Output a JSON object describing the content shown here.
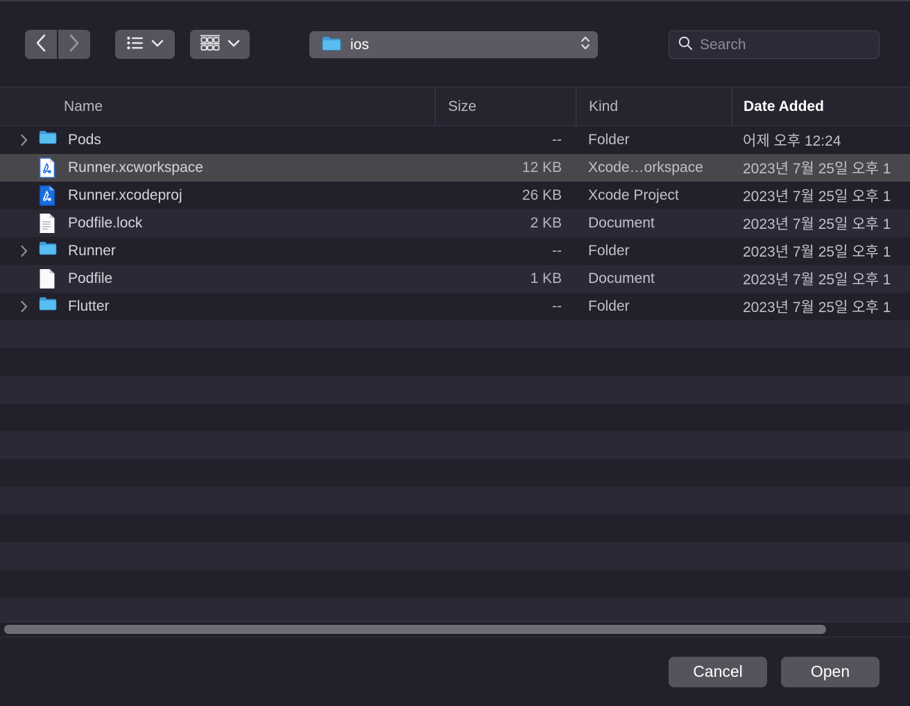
{
  "toolbar": {
    "back_icon": "chevron-left-icon",
    "forward_icon": "chevron-right-icon",
    "view_mode_icon": "list-view-icon",
    "view_mode_chevron": "chevron-down-icon",
    "group_mode_icon": "grid-view-icon",
    "group_mode_chevron": "chevron-down-icon",
    "path_label": "ios",
    "path_icon": "folder-icon",
    "path_stepper_icon": "up-down-chevron-icon",
    "search_icon": "magnifier-icon",
    "search_value": "",
    "search_placeholder": "Search"
  },
  "columns": [
    {
      "key": "name",
      "label": "Name",
      "sorted": false
    },
    {
      "key": "size",
      "label": "Size",
      "sorted": false
    },
    {
      "key": "kind",
      "label": "Kind",
      "sorted": false
    },
    {
      "key": "date",
      "label": "Date Added",
      "sorted": true
    }
  ],
  "files": [
    {
      "name": "Pods",
      "size": "--",
      "kind": "Folder",
      "date": "어제 오후 12:24",
      "icon": "folder-icon",
      "expandable": true,
      "selected": false
    },
    {
      "name": "Runner.xcworkspace",
      "size": "12 KB",
      "kind": "Xcode…orkspace",
      "date": "2023년 7월 25일 오후 1",
      "icon": "xcode-workspace-icon",
      "expandable": false,
      "selected": true
    },
    {
      "name": "Runner.xcodeproj",
      "size": "26 KB",
      "kind": "Xcode Project",
      "date": "2023년 7월 25일 오후 1",
      "icon": "xcode-project-icon",
      "expandable": false,
      "selected": false
    },
    {
      "name": "Podfile.lock",
      "size": "2 KB",
      "kind": "Document",
      "date": "2023년 7월 25일 오후 1",
      "icon": "text-document-icon",
      "expandable": false,
      "selected": false
    },
    {
      "name": "Runner",
      "size": "--",
      "kind": "Folder",
      "date": "2023년 7월 25일 오후 1",
      "icon": "folder-icon",
      "expandable": true,
      "selected": false
    },
    {
      "name": "Podfile",
      "size": "1 KB",
      "kind": "Document",
      "date": "2023년 7월 25일 오후 1",
      "icon": "blank-document-icon",
      "expandable": false,
      "selected": false
    },
    {
      "name": "Flutter",
      "size": "--",
      "kind": "Folder",
      "date": "2023년 7월 25일 오후 1",
      "icon": "folder-icon",
      "expandable": true,
      "selected": false
    }
  ],
  "footer": {
    "cancel_label": "Cancel",
    "open_label": "Open"
  },
  "colors": {
    "window_bg": "#22202b",
    "row_alt": "#2b2936",
    "row_selected": "#48474b",
    "header_bg": "#26242f",
    "control_bg": "#55545c",
    "folder_blue": "#3ba7e8",
    "xcode_blue": "#1a6ee0",
    "scrollbar_thumb": "#6e6d77"
  }
}
